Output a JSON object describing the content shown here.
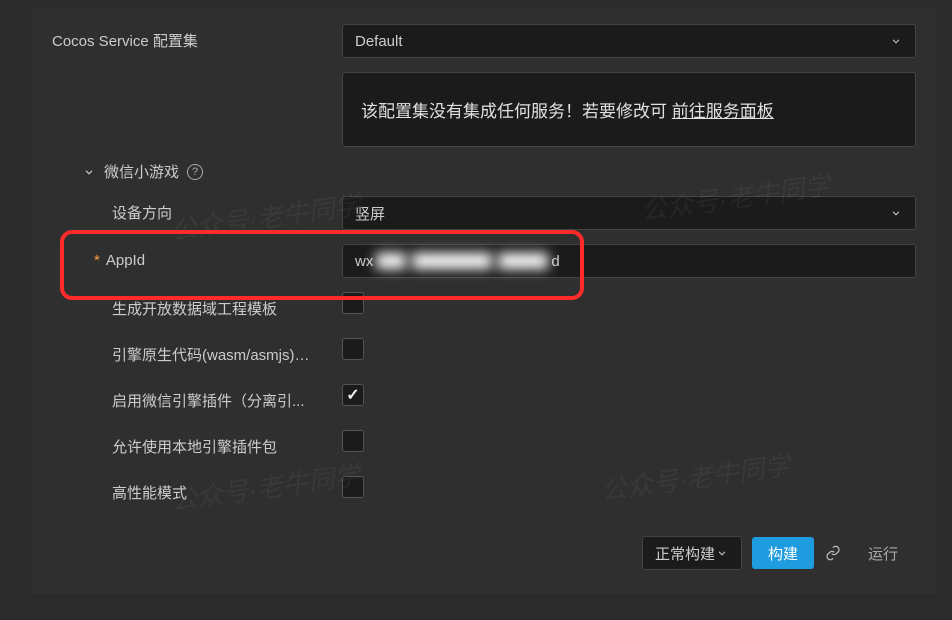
{
  "config_set": {
    "label": "Cocos Service 配置集",
    "value": "Default",
    "notice_prefix": "该配置集没有集成任何服务！若要修改可",
    "notice_link": "前往服务面板"
  },
  "section": {
    "title": "微信小游戏"
  },
  "fields": {
    "orientation": {
      "label": "设备方向",
      "value": "竖屏"
    },
    "appid": {
      "label": "AppId",
      "prefix": "wx",
      "suffix": "d"
    },
    "open_data": {
      "label": "生成开放数据域工程模板",
      "checked": false
    },
    "native_code": {
      "label": "引擎原生代码(wasm/asmjs)分包",
      "checked": false
    },
    "wx_engine_plugin": {
      "label": "启用微信引擎插件（分离引...",
      "checked": true
    },
    "local_plugin": {
      "label": "允许使用本地引擎插件包",
      "checked": false
    },
    "high_perf": {
      "label": "高性能模式",
      "checked": false
    }
  },
  "footer": {
    "mode": "正常构建",
    "build": "构建",
    "run": "运行"
  },
  "watermark": "公众号·老牛同学"
}
